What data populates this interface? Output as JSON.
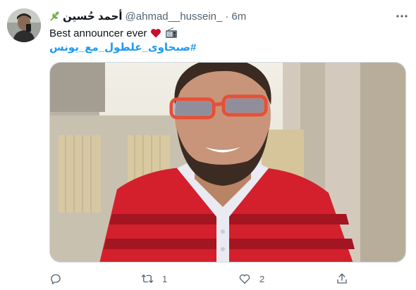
{
  "tweet": {
    "display_name": "أحمد حُسين",
    "handle": "@ahmad__hussein_",
    "separator": "·",
    "time": "6m",
    "text": "Best announcer ever",
    "hashtag": "#صبحاوى_علطول_مع_يونس",
    "colors": {
      "link": "#1d9bf0",
      "secondary": "#536471",
      "heart": "#c8102e"
    }
  },
  "actions": {
    "reply_count": "",
    "retweet_count": "1",
    "like_count": "2",
    "share_count": ""
  },
  "icons": [
    "leaf-emoji-icon",
    "red-heart-emoji-icon",
    "radio-emoji-icon",
    "more-icon",
    "reply-icon",
    "retweet-icon",
    "like-icon",
    "share-icon"
  ]
}
